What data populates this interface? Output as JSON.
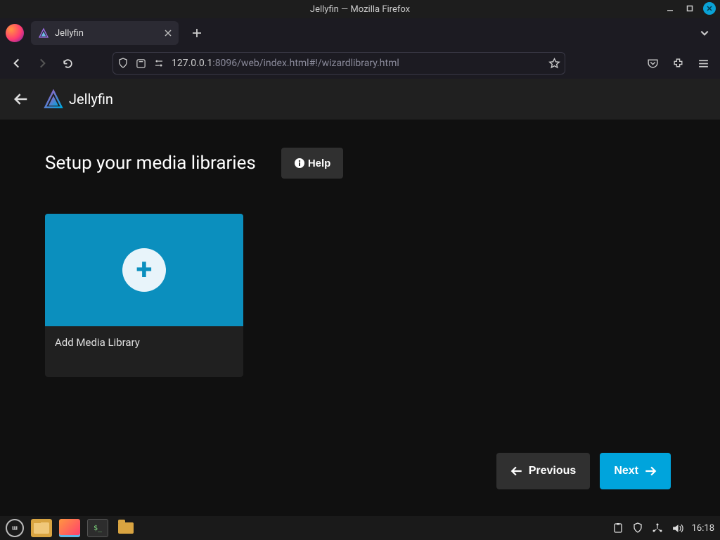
{
  "window": {
    "title": "Jellyfin — Mozilla Firefox"
  },
  "browser": {
    "tab_label": "Jellyfin",
    "url_host": "127.0.0.1",
    "url_port_path": ":8096/web/index.html#!/wizardlibrary.html"
  },
  "app": {
    "brand": "Jellyfin"
  },
  "page": {
    "title": "Setup your media libraries",
    "help_label": "Help",
    "card_label": "Add Media Library",
    "prev_label": "Previous",
    "next_label": "Next"
  },
  "taskbar": {
    "clock": "16:18"
  }
}
